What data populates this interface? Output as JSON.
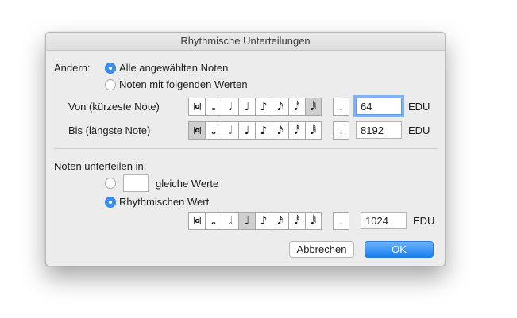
{
  "dialog": {
    "title": "Rhythmische Unterteilungen"
  },
  "change": {
    "label": "Ändern:",
    "option_all": "Alle angewählten Noten",
    "option_values": "Noten mit folgenden Werten",
    "selected": "option_all"
  },
  "from": {
    "label": "Von (kürzeste Note)",
    "value": "64",
    "unit": "EDU",
    "selected_note": "128th"
  },
  "to": {
    "label": "Bis (längste Note)",
    "value": "8192",
    "unit": "EDU",
    "selected_note": "breve"
  },
  "subdivide": {
    "label": "Noten unterteilen in:",
    "option_equal": "gleiche Werte",
    "equal_count": "",
    "option_rhythmic": "Rhythmischen Wert",
    "selected": "option_rhythmic",
    "value": "1024",
    "unit": "EDU",
    "selected_note": "quarter"
  },
  "note_palette": {
    "breve": "|o|",
    "whole": "𝅝",
    "half": "𝅗𝅥",
    "quarter": "♩",
    "eighth": "♪",
    "sixteenth": "𝅘𝅥𝅯",
    "thirtysecond": "𝅘𝅥𝅰",
    "sixtyfourth": "𝅘𝅥𝅱",
    "dot": "."
  },
  "buttons": {
    "cancel": "Abbrechen",
    "ok": "OK"
  },
  "colors": {
    "accent": "#3b8ff0",
    "dialog_bg": "#ececec",
    "selected_note": "#cfcfcf"
  }
}
